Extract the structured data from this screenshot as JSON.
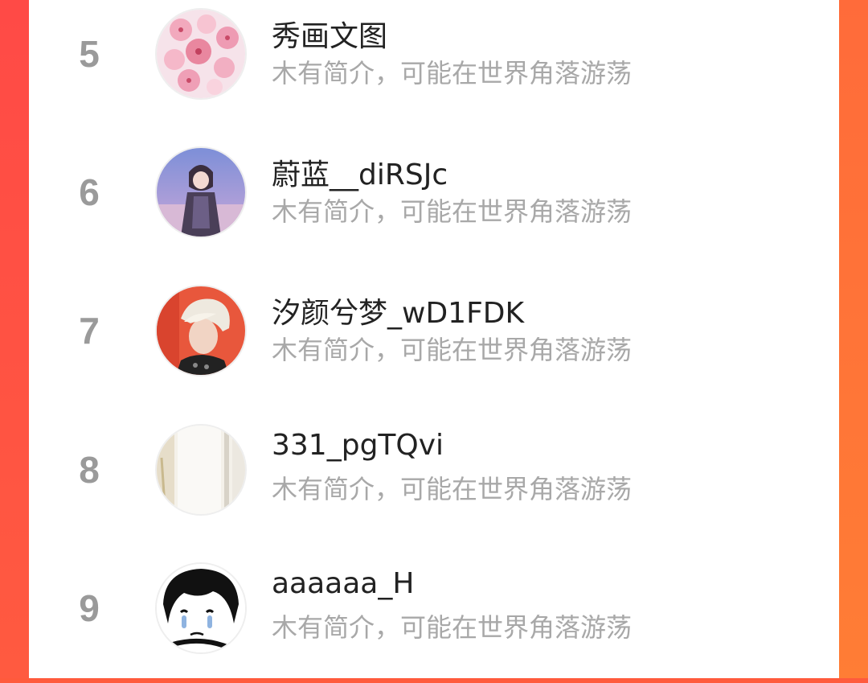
{
  "colors": {
    "accent": "#ff5a3c",
    "rank_text": "#9a9a9a",
    "name_text": "#222222",
    "bio_text": "#a8a8a8",
    "panel_bg": "#ffffff"
  },
  "users": [
    {
      "rank": "5",
      "name": "秀画文图",
      "bio": "木有简介，可能在世界角落游荡",
      "avatar_icon": "cherry-blossom-avatar-icon"
    },
    {
      "rank": "6",
      "name": "蔚蓝__diRSJc",
      "bio": "木有简介，可能在世界角落游荡",
      "avatar_icon": "anime-girl-avatar-icon"
    },
    {
      "rank": "7",
      "name": "汐颜兮梦_wD1FDK",
      "bio": "木有简介，可能在世界角落游荡",
      "avatar_icon": "blond-man-avatar-icon"
    },
    {
      "rank": "8",
      "name": "331_pgTQvi",
      "bio": "木有简介，可能在世界角落游荡",
      "avatar_icon": "white-room-avatar-icon"
    },
    {
      "rank": "9",
      "name": "aaaaaa_H",
      "bio": "木有简介，可能在世界角落游荡",
      "avatar_icon": "crying-sketch-avatar-icon"
    }
  ]
}
